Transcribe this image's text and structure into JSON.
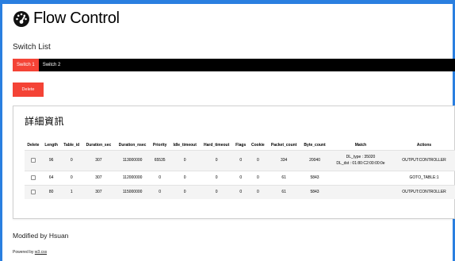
{
  "header": {
    "title": "Flow Control",
    "icon": "dashboard-gauge-icon"
  },
  "switch_list": {
    "label": "Switch List",
    "tabs": [
      {
        "label": "Switch 1",
        "active": true
      },
      {
        "label": "Switch 2",
        "active": false
      }
    ]
  },
  "toolbar": {
    "delete_label": "Delete"
  },
  "details": {
    "title": "詳細資訊",
    "columns": [
      "Delete",
      "Length",
      "Table_id",
      "Duration_sec",
      "Duration_nsec",
      "Priority",
      "Idle_timeout",
      "Hard_timeout",
      "Flags",
      "Cookie",
      "Packet_count",
      "Byte_count",
      "Match",
      "Actions"
    ],
    "rows": [
      {
        "length": "96",
        "table_id": "0",
        "duration_sec": "307",
        "duration_nsec": "113000000",
        "priority": "65535",
        "idle_timeout": "0",
        "hard_timeout": "0",
        "flags": "0",
        "cookie": "0",
        "packet_count": "334",
        "byte_count": "20040",
        "match_line1": "DL_type : 35020",
        "match_line2": "DL_dst : 01:80:C2:00:00:0e",
        "actions": "OUTPUT:CONTROLLER"
      },
      {
        "length": "64",
        "table_id": "0",
        "duration_sec": "307",
        "duration_nsec": "112000000",
        "priority": "0",
        "idle_timeout": "0",
        "hard_timeout": "0",
        "flags": "0",
        "cookie": "0",
        "packet_count": "61",
        "byte_count": "5843",
        "match_line1": "",
        "match_line2": "",
        "actions": "GOTO_TABLE:1"
      },
      {
        "length": "80",
        "table_id": "1",
        "duration_sec": "307",
        "duration_nsec": "115000000",
        "priority": "0",
        "idle_timeout": "0",
        "hard_timeout": "0",
        "flags": "0",
        "cookie": "0",
        "packet_count": "61",
        "byte_count": "5843",
        "match_line1": "",
        "match_line2": "",
        "actions": "OUTPUT:CONTROLLER"
      }
    ]
  },
  "footer": {
    "title": "Modified by Hsuan",
    "powered_prefix": "Powered by ",
    "powered_link": "w3.css"
  },
  "colors": {
    "accent": "#f44336",
    "frame": "#2a7fe0",
    "tabbar": "#000000"
  }
}
